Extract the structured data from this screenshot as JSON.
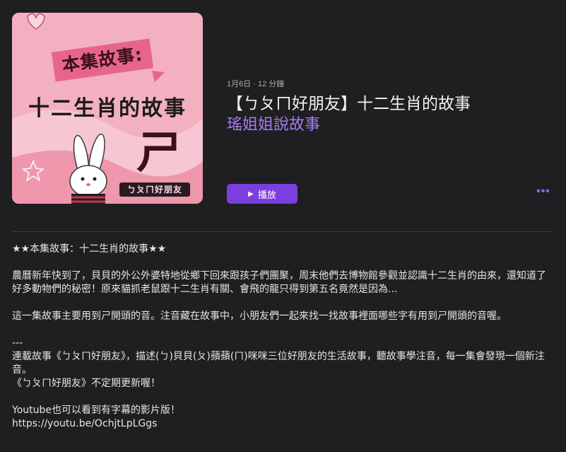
{
  "artwork": {
    "banner_text": "本集故事:",
    "title_text": "十二生肖的故事",
    "letter": "ㄕ",
    "brand_text": "ㄅㄆㄇ好朋友"
  },
  "episode": {
    "meta": "1月6日 · 12 分鐘",
    "title": "【ㄅㄆㄇ好朋友】十二生肖的故事",
    "show_name": "瑤姐姐說故事",
    "play_label": "播放",
    "play_icon": "▶",
    "more_icon": "•••"
  },
  "description": {
    "heading": "★★本集故事：十二生肖的故事★★",
    "para1": "農曆新年快到了，貝貝的外公外婆特地從鄉下回來跟孩子們團聚，周末他們去博物館參觀並認識十二生肖的由來，還知道了好多動物們的秘密！原來貓抓老鼠跟十二生肖有關、會飛的龍只得到第五名竟然是因為...",
    "para2": "這一集故事主要用到ㄕ開頭的音。注音藏在故事中，小朋友們一起來找一找故事裡面哪些字有用到ㄕ開頭的音喔。",
    "separator": "---",
    "para3": "連載故事《ㄅㄆㄇ好朋友》，描述(ㄅ)貝貝(ㄆ)蘋蘋(ㄇ)咪咪三位好朋友的生活故事，聽故事學注音，每一集會發現一個新注音。",
    "para4": "《ㄅㄆㄇ好朋友》不定期更新喔！",
    "para5": "Youtube也可以看到有字幕的影片版！",
    "link": "https://youtu.be/OchjtLpLGgs"
  }
}
